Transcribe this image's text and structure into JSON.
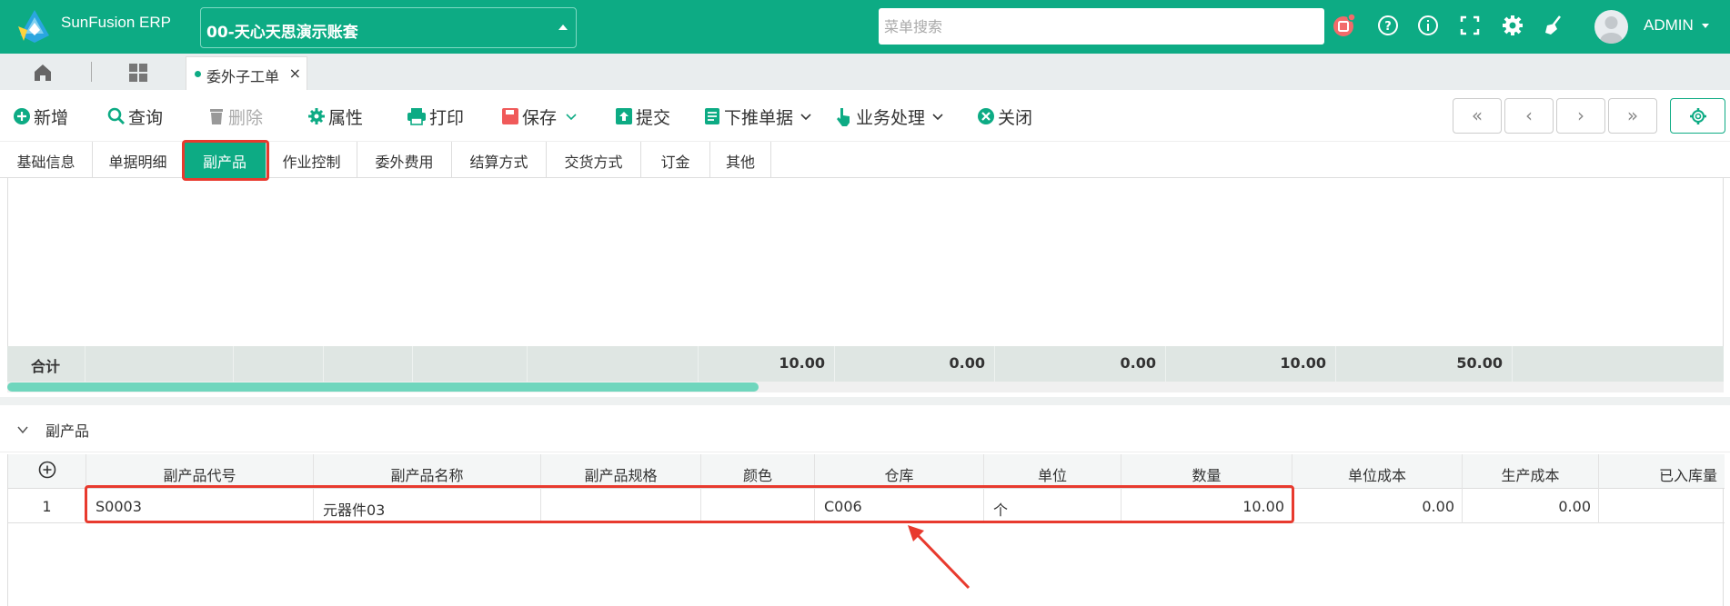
{
  "app": {
    "brand": "SunFusion ERP",
    "org": "00-天心天思演示账套",
    "search_placeholder": "菜单搜索",
    "user": "ADMIN"
  },
  "tabs": {
    "active_tab": "委外子工单"
  },
  "toolbar": {
    "new": "新增",
    "query": "查询",
    "delete": "删除",
    "props": "属性",
    "print": "打印",
    "save": "保存",
    "submit": "提交",
    "push": "下推单据",
    "business": "业务处理",
    "close": "关闭"
  },
  "section_tabs": [
    "基础信息",
    "单据明细",
    "副产品",
    "作业控制",
    "委外费用",
    "结算方式",
    "交货方式",
    "订金",
    "其他"
  ],
  "summary": {
    "label": "合计",
    "values": [
      "10.00",
      "0.00",
      "0.00",
      "10.00",
      "50.00"
    ]
  },
  "section": {
    "title": "副产品"
  },
  "table": {
    "headers": [
      "副产品代号",
      "副产品名称",
      "副产品规格",
      "颜色",
      "仓库",
      "单位",
      "数量",
      "单位成本",
      "生产成本",
      "已入库量"
    ],
    "rows": [
      {
        "no": "1",
        "code": "S0003",
        "name": "元器件03",
        "spec": "",
        "color": "",
        "warehouse": "C006",
        "unit": "个",
        "qty": "10.00",
        "unit_cost": "0.00",
        "prod_cost": "0.00",
        "stocked": ""
      }
    ]
  },
  "colors": {
    "primary": "#0dab84",
    "highlight": "#e83a2e"
  }
}
